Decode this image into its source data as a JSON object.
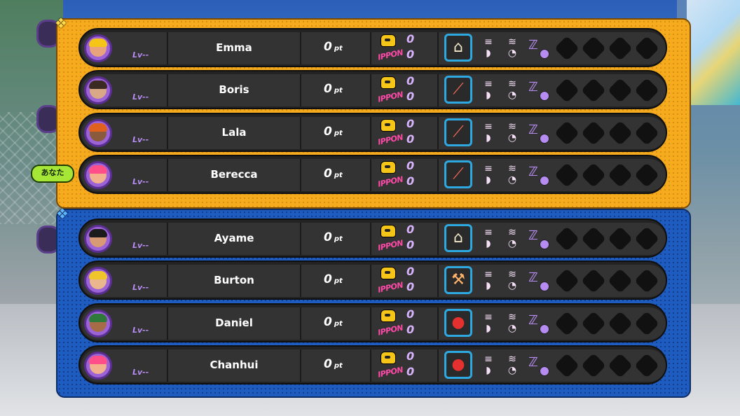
{
  "colors": {
    "team_a_panel": "#f5ab1d",
    "team_b_panel": "#1f5cc0",
    "row_bg": "#333333",
    "ippon_label": "#ff4aa8",
    "level_text": "#b78cf2"
  },
  "you_badge": "あなた",
  "teams": [
    {
      "emblem_icon": "dragon-emblem-icon",
      "players": [
        {
          "name": "Emma",
          "level": "Lv--",
          "points": "0",
          "points_unit": "pt",
          "ippon_label": "IPPON",
          "ippon_top": "0",
          "ippon_bottom": "0",
          "weapon_icon": "fan-weapon-icon",
          "hair_color": "#f5c518",
          "skin_color": "#e8a37e"
        },
        {
          "name": "Boris",
          "level": "Lv--",
          "points": "0",
          "points_unit": "pt",
          "ippon_label": "IPPON",
          "ippon_top": "0",
          "ippon_bottom": "0",
          "weapon_icon": "bat-weapon-icon",
          "hair_color": "#3b2a22",
          "skin_color": "#d9a886"
        },
        {
          "name": "Lala",
          "level": "Lv--",
          "points": "0",
          "points_unit": "pt",
          "ippon_label": "IPPON",
          "ippon_top": "0",
          "ippon_bottom": "0",
          "weapon_icon": "bat-weapon-icon",
          "hair_color": "#e0611e",
          "skin_color": "#8a5a3c"
        },
        {
          "name": "Berecca",
          "level": "Lv--",
          "points": "0",
          "points_unit": "pt",
          "ippon_label": "IPPON",
          "ippon_top": "0",
          "ippon_bottom": "0",
          "weapon_icon": "bat-weapon-icon",
          "hair_color": "#ff4f8b",
          "skin_color": "#f2b08e"
        }
      ]
    },
    {
      "emblem_icon": "dragon-emblem-icon",
      "players": [
        {
          "name": "Ayame",
          "level": "Lv--",
          "points": "0",
          "points_unit": "pt",
          "ippon_label": "IPPON",
          "ippon_top": "0",
          "ippon_bottom": "0",
          "weapon_icon": "fan-weapon-icon",
          "hair_color": "#1b1b1b",
          "skin_color": "#d79a74"
        },
        {
          "name": "Burton",
          "level": "Lv--",
          "points": "0",
          "points_unit": "pt",
          "ippon_label": "IPPON",
          "ippon_top": "0",
          "ippon_bottom": "0",
          "weapon_icon": "hammer-weapon-icon",
          "hair_color": "#f0c52c",
          "skin_color": "#e9b68e"
        },
        {
          "name": "Daniel",
          "level": "Lv--",
          "points": "0",
          "points_unit": "pt",
          "ippon_label": "IPPON",
          "ippon_top": "0",
          "ippon_bottom": "0",
          "weapon_icon": "ball-weapon-icon",
          "hair_color": "#2f7a3a",
          "skin_color": "#a66c47"
        },
        {
          "name": "Chanhui",
          "level": "Lv--",
          "points": "0",
          "points_unit": "pt",
          "ippon_label": "IPPON",
          "ippon_top": "0",
          "ippon_bottom": "0",
          "weapon_icon": "ball-weapon-icon",
          "hair_color": "#ff4f8b",
          "skin_color": "#f2b08e"
        }
      ]
    }
  ]
}
